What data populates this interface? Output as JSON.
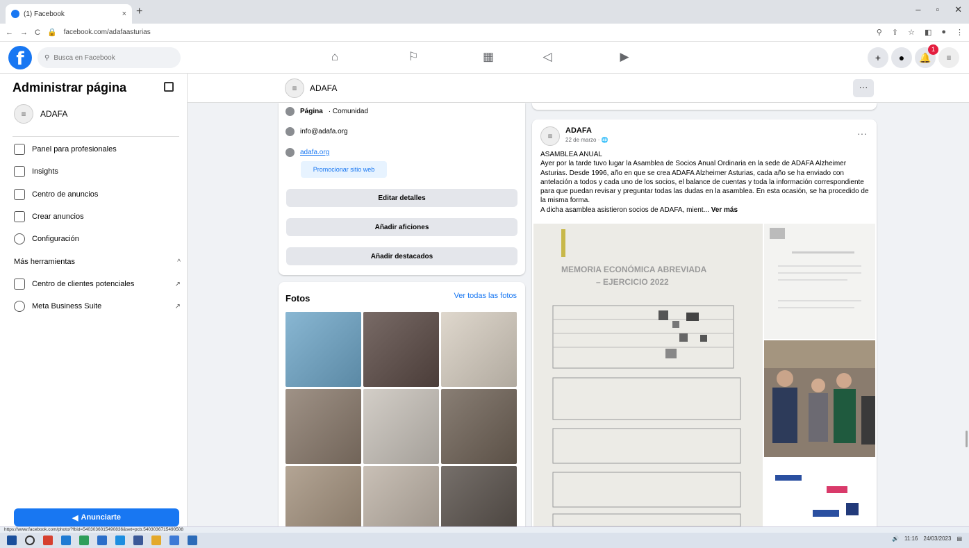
{
  "browser": {
    "tab_title": "(1) Facebook",
    "tab_close": "×",
    "new_tab": "+",
    "url": "facebook.com/adafaasturias",
    "back": "←",
    "forward": "→",
    "reload": "C",
    "minimize": "–",
    "restore": "▫",
    "close": "✕"
  },
  "fb_nav": {
    "logo": "f",
    "search_placeholder": "Busca en Facebook",
    "notifications_count": "1"
  },
  "sidebar": {
    "title": "Administrar página",
    "page_name": "ADAFA",
    "items": [
      {
        "label": "Panel para profesionales"
      },
      {
        "label": "Insights"
      },
      {
        "label": "Centro de anuncios"
      },
      {
        "label": "Crear anuncios"
      },
      {
        "label": "Configuración"
      }
    ],
    "more_tools": "Más herramientas",
    "more_tools_chevron": "^",
    "tools": [
      {
        "label": "Centro de clientes potenciales",
        "arrow": "↗"
      },
      {
        "label": "Meta Business Suite",
        "arrow": "↗"
      }
    ],
    "promote_button": "Anunciarte"
  },
  "page_header": {
    "name": "ADAFA",
    "more": "···"
  },
  "intro": {
    "category_label": "Página",
    "category_value": "· Comunidad",
    "email": "info@adafa.org",
    "website": "adafa.org",
    "promote_site": "Promocionar sitio web",
    "edit_details": "Editar detalles",
    "add_hobbies": "Añadir aficiones",
    "add_featured": "Añadir destacados"
  },
  "photos": {
    "title": "Fotos",
    "see_all": "Ver todas las fotos",
    "tiles": [
      {
        "bg": "#6fa7c9"
      },
      {
        "bg": "#5b4a45"
      },
      {
        "bg": "#d8cfc2"
      },
      {
        "bg": "#8a7a6c"
      },
      {
        "bg": "#c9c3bb"
      },
      {
        "bg": "#6f6256"
      },
      {
        "bg": "#a3917d"
      },
      {
        "bg": "#bdb2a6"
      },
      {
        "bg": "#58504a"
      }
    ]
  },
  "post": {
    "author": "ADAFA",
    "date": "22 de marzo · ",
    "more": "···",
    "heading": "ASAMBLEA ANUAL",
    "body": "Ayer por la tarde tuvo lugar la Asamblea de Socios Anual Ordinaria en la sede de ADAFA Alzheimer Asturias. Desde 1996, año en que se crea ADAFA Alzheimer Asturias, cada año se ha enviado con antelación a todos y cada uno de los socios, el balance de cuentas y toda la información correspondiente para que puedan revisar y preguntar todas las dudas en la asamblea. En esta ocasión, se ha procedido de la misma forma.",
    "last_line": "A dicha asamblea asistieron socios de ADAFA, mient...",
    "see_more": "Ver más",
    "doc_title_1": "MEMORIA ECONÓMICA ABREVIADA",
    "doc_title_2": "– EJERCICIO 2022"
  },
  "status_url": "https://www.facebook.com/photo/?fbid=5403036015490836&set=pcb.5403036715490508",
  "taskbar": {
    "time": "11:16",
    "date": "24/03/2023"
  },
  "colors": {
    "fb_blue": "#1877f2",
    "bg": "#f0f2f5",
    "button_gray": "#e4e6eb"
  }
}
